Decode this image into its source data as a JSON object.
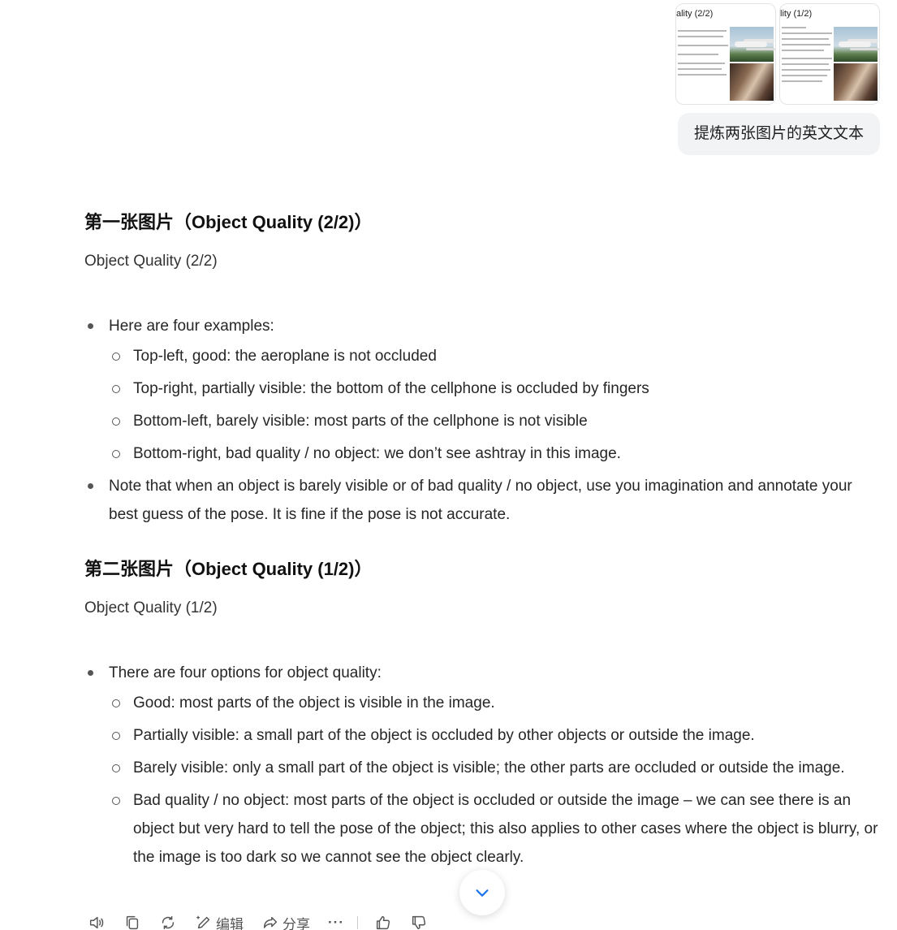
{
  "user_message": {
    "thumbnails": [
      {
        "title": "ality (2/2)"
      },
      {
        "title": "lity (1/2)"
      }
    ],
    "text": "提炼两张图片的英文文本"
  },
  "answer": {
    "sections": [
      {
        "title": "第一张图片（Object Quality (2/2)）",
        "subtitle": "Object Quality (2/2)",
        "items": [
          {
            "text": "Here are four examples:",
            "subitems": [
              "Top-left, good: the aeroplane is not occluded",
              "Top-right, partially visible: the bottom of the cellphone is occluded by fingers",
              "Bottom-left, barely visible: most parts of the cellphone is not visible",
              "Bottom-right, bad quality / no object: we don’t see ashtray in this image."
            ]
          },
          {
            "text": "Note that when an object is barely visible or of bad quality / no object, use you imagination and annotate your best guess of the pose. It is fine if the pose is not accurate."
          }
        ]
      },
      {
        "title": "第二张图片（Object Quality (1/2)）",
        "subtitle": "Object Quality (1/2)",
        "items": [
          {
            "text": "There are four options for object quality:",
            "subitems": [
              "Good: most parts of the object is visible in the image.",
              "Partially visible: a small part of the object is occluded by other objects or outside the image.",
              "Barely visible: only a small part of the object is visible; the other parts are occluded or outside the image.",
              "Bad quality / no object: most parts of the object is occluded or outside the image – we can see there is an object but very hard to tell the pose of the object; this also applies to other cases where the object is blurry, or the image is too dark so we cannot see the object clearly."
            ]
          }
        ]
      }
    ]
  },
  "toolbar": {
    "edit_label": "编辑",
    "share_label": "分享",
    "more_label": "···",
    "icons": [
      "speaker-icon",
      "copy-icon",
      "regenerate-icon",
      "edit-icon",
      "share-icon",
      "more-icon",
      "thumbs-up-icon",
      "thumbs-down-icon"
    ]
  },
  "colors": {
    "bubble_bg": "#f2f3f5",
    "accent": "#1a73e8"
  }
}
